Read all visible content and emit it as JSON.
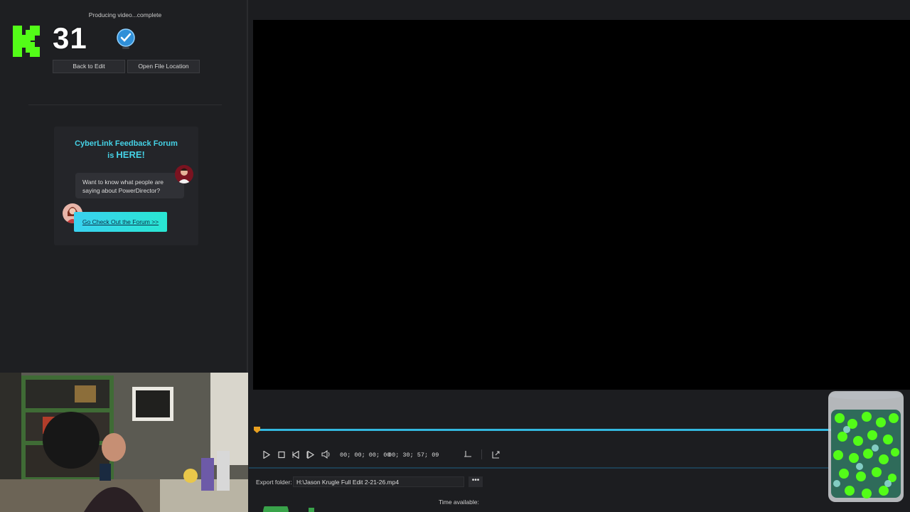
{
  "produce": {
    "status": "Producing video...complete",
    "back_label": "Back to Edit",
    "open_label": "Open File Location"
  },
  "overlay": {
    "kick_count": "31"
  },
  "forum": {
    "title_line1": "CyberLink Feedback Forum",
    "title_line2_prefix": "is ",
    "title_line2_highlight": "HERE!",
    "bubble_line1": "Want to know what people are",
    "bubble_line2": "saying about PowerDirector?",
    "cta": "Go Check Out the Forum >>"
  },
  "player": {
    "current_time": "00; 00; 00; 00",
    "total_time": "00; 30; 57; 09",
    "progress": 0.0
  },
  "export": {
    "folder_label": "Export folder:",
    "folder_value": "H:\\Jason Krugle Full Edit 2-21-26.mp4",
    "more_label": "•••",
    "time_available_label": "Time available:"
  },
  "colors": {
    "accent": "#45d2e6",
    "kick_green": "#53fc18",
    "timeline": "#33b8df"
  }
}
